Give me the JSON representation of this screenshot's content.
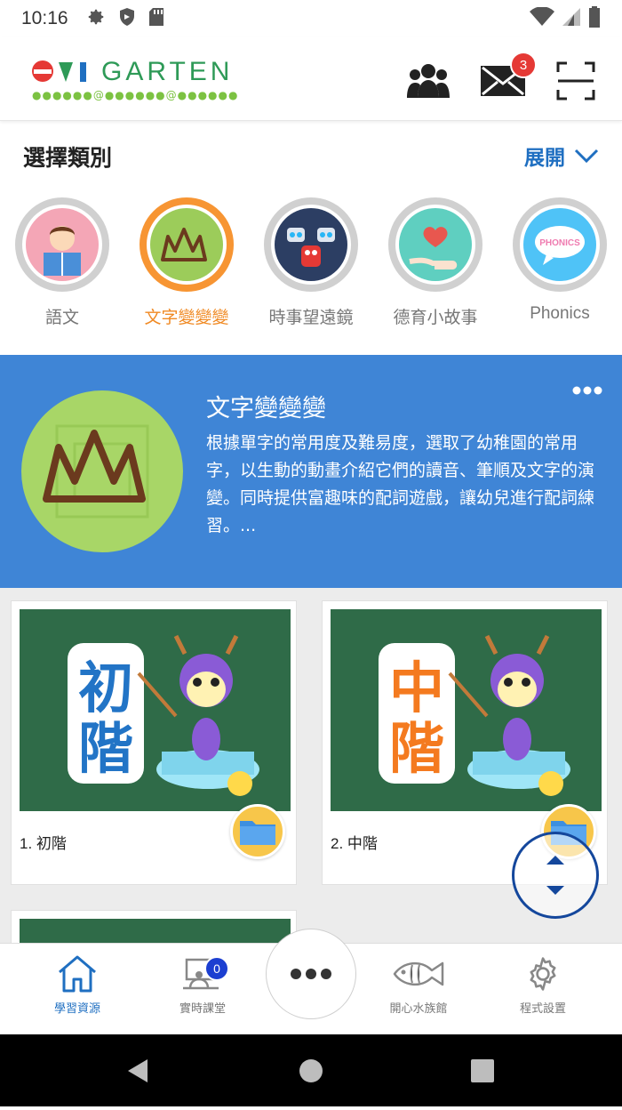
{
  "status_bar": {
    "time": "10:16"
  },
  "header": {
    "logo_prefix": "OVI",
    "logo_text": "GARTEN",
    "logo_dots": "●●●●●●@●●●●●●@●●●●●●",
    "mail_badge": "3"
  },
  "category_section": {
    "title": "選擇類別",
    "expand_label": "展開"
  },
  "categories": [
    {
      "label": "語文",
      "active": false
    },
    {
      "label": "文字變變變",
      "active": true
    },
    {
      "label": "時事望遠鏡",
      "active": false
    },
    {
      "label": "德育小故事",
      "active": false
    },
    {
      "label": "Phonics",
      "active": false
    }
  ],
  "phonics_icon_text": "PHONICS",
  "banner": {
    "title": "文字變變變",
    "description": "根據單字的常用度及難易度，選取了幼稚園的常用字，以生動的動畫介紹它們的讀音、筆順及文字的演變。同時提供富趣味的配詞遊戲，讓幼兒進行配詞練習。..."
  },
  "cards": [
    {
      "label": "1. 初階",
      "thumb_text_top": "初",
      "thumb_text_bottom": "階",
      "thumb_color": "#2274c6"
    },
    {
      "label": "2. 中階",
      "thumb_text_top": "中",
      "thumb_text_bottom": "階",
      "thumb_color": "#f47a1f"
    }
  ],
  "bottom_nav": {
    "learning": "學習資源",
    "live_class": "實時課堂",
    "live_badge": "0",
    "aquarium": "開心水族館",
    "settings": "程式設置"
  },
  "colors": {
    "accent_blue": "#1f6fc1",
    "banner_blue": "#3f85d6",
    "active_orange": "#f08a24"
  }
}
